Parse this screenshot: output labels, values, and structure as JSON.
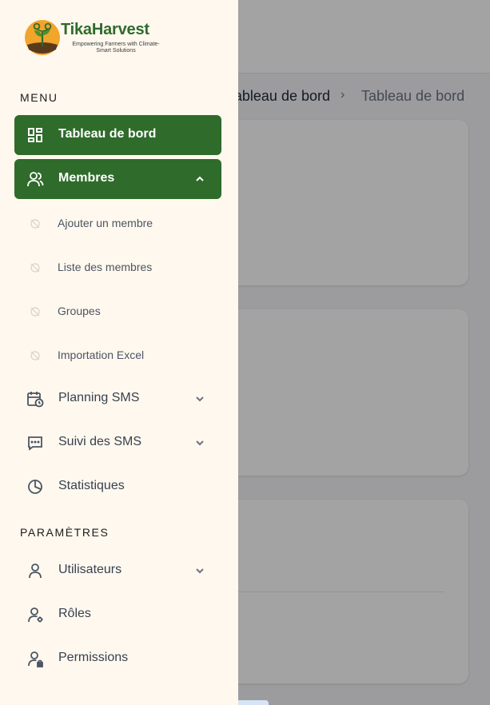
{
  "brand": {
    "name": "TikaHarvest",
    "tagline": "Empowering Farmers with Climate-Smart Solutions"
  },
  "background": {
    "breadcrumb": [
      "ableau de bord",
      "Tableau de bord"
    ],
    "breadcrumb_separator": "›"
  },
  "sidebar": {
    "menu_title": "MENU",
    "settings_title": "PARAMÈTRES",
    "menu_items": [
      {
        "label": "Tableau de bord",
        "icon": "dashboard-icon",
        "active": true
      },
      {
        "label": "Membres",
        "icon": "users-icon",
        "active": true,
        "expanded": true
      },
      {
        "label": "Planning SMS",
        "icon": "calendar-clock-icon",
        "expandable": true
      },
      {
        "label": "Suivi des SMS",
        "icon": "message-dots-icon",
        "expandable": true
      },
      {
        "label": "Statistiques",
        "icon": "pie-chart-icon"
      }
    ],
    "members_submenu": [
      {
        "label": "Ajouter un membre",
        "icon": "eye-off-icon"
      },
      {
        "label": "Liste des membres",
        "icon": "eye-off-icon"
      },
      {
        "label": "Groupes",
        "icon": "eye-off-icon"
      },
      {
        "label": "Importation Excel",
        "icon": "eye-off-icon"
      }
    ],
    "settings_items": [
      {
        "label": "Utilisateurs",
        "icon": "user-icon",
        "expandable": true
      },
      {
        "label": "Rôles",
        "icon": "user-gear-icon"
      },
      {
        "label": "Permissions",
        "icon": "user-lock-icon"
      }
    ]
  },
  "colors": {
    "accent": "#2f6b2b",
    "sidebar_bg": "#fff8ee"
  }
}
